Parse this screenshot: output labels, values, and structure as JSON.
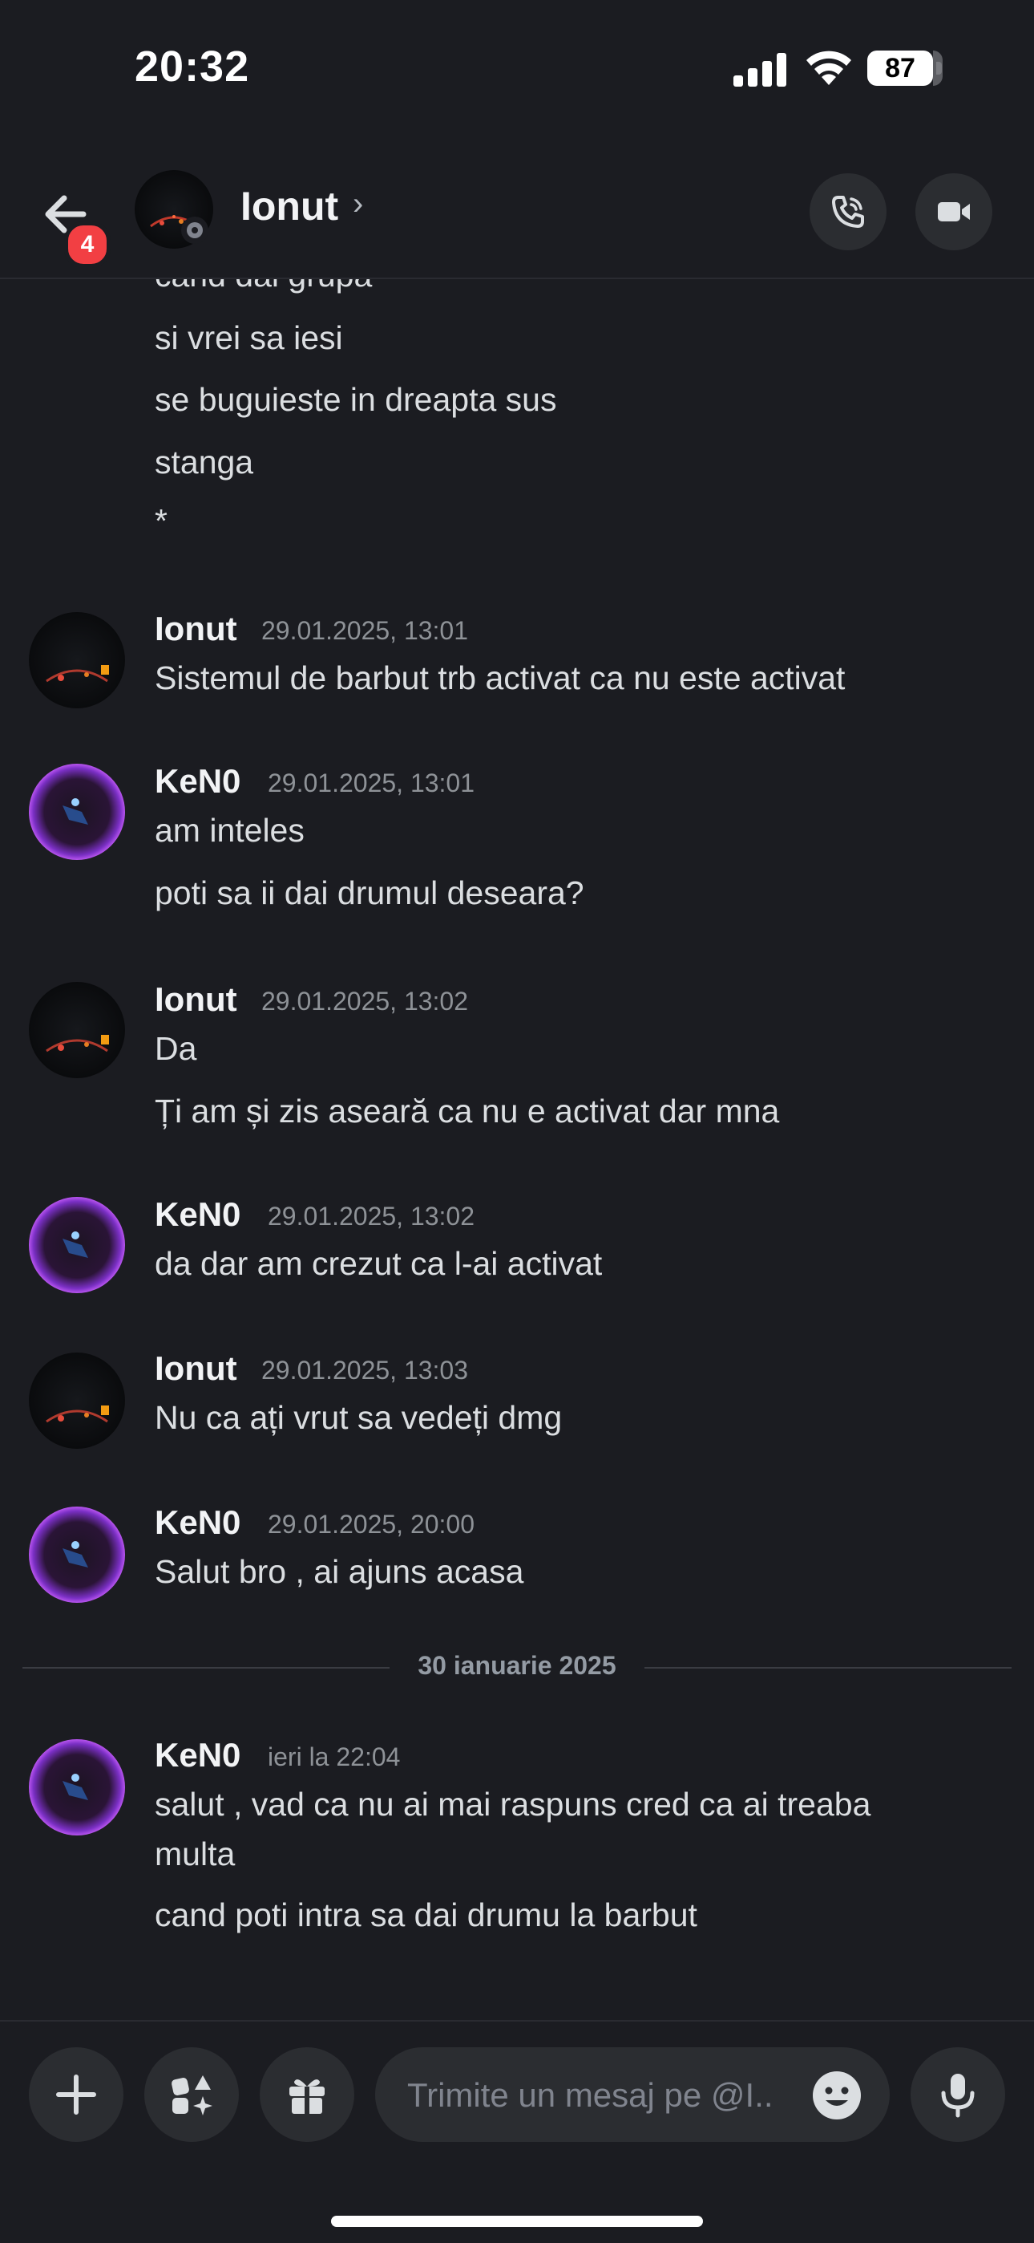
{
  "status_bar": {
    "time": "20:32",
    "battery": "87",
    "battery_level": 0.87
  },
  "header": {
    "back_badge": "4",
    "contact_name": "Ionut",
    "chevron": "›"
  },
  "colors": {
    "background": "#1b1c21",
    "surface": "#2b2d31",
    "badge_red": "#f23f43",
    "text": "#dbdee1",
    "muted": "#8e9297"
  },
  "messages": {
    "continuation": [
      "cand dai grupa",
      "si vrei sa iesi",
      "se buguieste in dreapta sus",
      "stanga",
      "*"
    ],
    "m1": {
      "author": "Ionut",
      "time": "29.01.2025, 13:01",
      "lines": [
        "Sistemul de barbut trb activat ca nu este activat"
      ]
    },
    "m2": {
      "author": "KeN0",
      "time": "29.01.2025, 13:01",
      "lines": [
        "am inteles",
        "poti sa ii dai drumul deseara?"
      ]
    },
    "m3": {
      "author": "Ionut",
      "time": "29.01.2025, 13:02",
      "lines": [
        "Da",
        "Ți am și zis aseară ca nu e activat dar mna"
      ]
    },
    "m4": {
      "author": "KeN0",
      "time": "29.01.2025, 13:02",
      "lines": [
        "da dar am crezut ca l-ai activat"
      ]
    },
    "m5": {
      "author": "Ionut",
      "time": "29.01.2025, 13:03",
      "lines": [
        "Nu ca ați vrut sa vedeți dmg"
      ]
    },
    "m6": {
      "author": "KeN0",
      "time": "29.01.2025, 20:00",
      "lines": [
        "Salut bro , ai ajuns acasa"
      ]
    },
    "date_divider": "30 ianuarie 2025",
    "m7": {
      "author": "KeN0",
      "time": "ieri la 22:04",
      "lines": [
        "salut , vad ca nu ai mai raspuns cred ca ai treaba",
        "multa",
        "cand poti intra sa dai drumu la barbut"
      ]
    }
  },
  "composer": {
    "placeholder": "Trimite un mesaj pe @I.."
  },
  "icons": [
    "back-arrow-icon",
    "phone-call-icon",
    "video-camera-icon",
    "plus-icon",
    "apps-icon",
    "gift-icon",
    "emoji-icon",
    "microphone-icon"
  ]
}
